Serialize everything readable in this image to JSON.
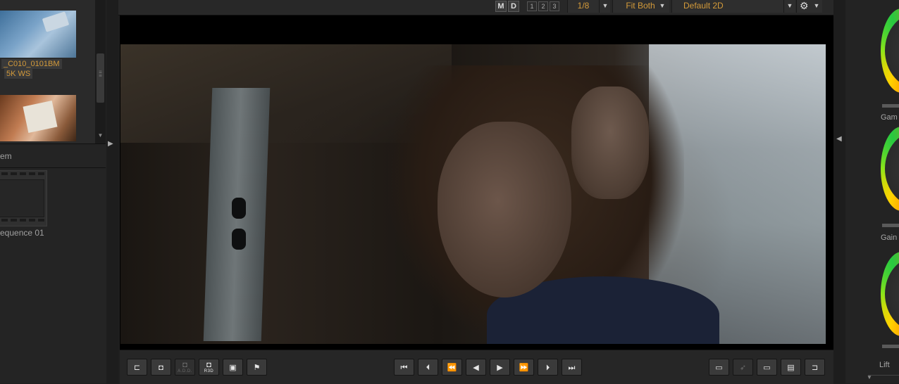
{
  "browser": {
    "clip_name": "_C010_0101BM",
    "clip_format": "5K WS",
    "section_label": "em",
    "sequence_name": "equence 01"
  },
  "viewer_toolbar": {
    "m_label": "M",
    "d_label": "D",
    "layouts": [
      "1",
      "2",
      "3"
    ],
    "resolution": "1/8",
    "fit_mode": "Fit Both",
    "look": "Default 2D",
    "accent_color": "#d39a3a"
  },
  "transport": {
    "left_tools": [
      {
        "name": "trim-tool",
        "icon": "trim-icon",
        "glyph": "⊏",
        "sub": ""
      },
      {
        "name": "snapshot",
        "icon": "camera-icon",
        "glyph": "◘",
        "sub": ""
      },
      {
        "name": "add-snapshot",
        "icon": "camera-add-icon",
        "glyph": "◘",
        "sub": "A.D.D."
      },
      {
        "name": "r3d-snapshot",
        "icon": "camera-r3d-icon",
        "glyph": "◘",
        "sub": "R3D"
      },
      {
        "name": "preview",
        "icon": "preview-icon",
        "glyph": "▣",
        "sub": ""
      },
      {
        "name": "flag",
        "icon": "flag-icon",
        "glyph": "⚑",
        "sub": ""
      }
    ],
    "playback": [
      {
        "name": "go-to-start",
        "icon": "skip-start-icon",
        "glyph": "⏮"
      },
      {
        "name": "previous-frame",
        "icon": "step-back-icon",
        "glyph": "⏴"
      },
      {
        "name": "rewind",
        "icon": "rewind-icon",
        "glyph": "⏪"
      },
      {
        "name": "play-reverse",
        "icon": "play-reverse-icon",
        "glyph": "◀"
      },
      {
        "name": "play",
        "icon": "play-icon",
        "glyph": "▶"
      },
      {
        "name": "fast-forward",
        "icon": "fast-forward-icon",
        "glyph": "⏩"
      },
      {
        "name": "next-frame",
        "icon": "step-forward-icon",
        "glyph": "⏵"
      },
      {
        "name": "go-to-end",
        "icon": "skip-end-icon",
        "glyph": "⏭"
      }
    ],
    "right_tools": [
      {
        "name": "monitor",
        "icon": "monitor-icon",
        "glyph": "▭"
      },
      {
        "name": "render",
        "icon": "rocket-icon",
        "glyph": "➶"
      },
      {
        "name": "aspect",
        "icon": "aspect-icon",
        "glyph": "▭"
      },
      {
        "name": "timecode",
        "icon": "clapper-icon",
        "glyph": "▤"
      },
      {
        "name": "trim-right",
        "icon": "trim-icon",
        "glyph": "⊐"
      }
    ]
  },
  "grading": {
    "labels": [
      "Gam",
      "Gain",
      "Lift"
    ]
  }
}
